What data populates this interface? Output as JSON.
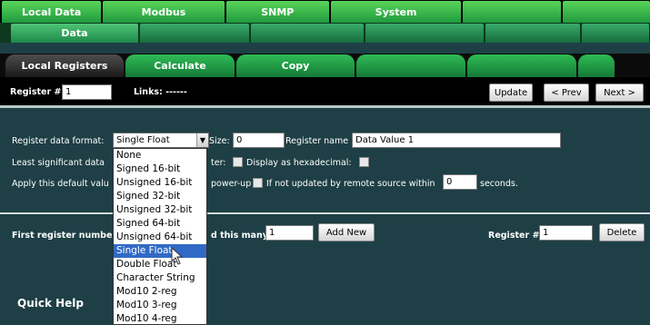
{
  "nav_primary": [
    "Local Data",
    "Modbus",
    "SNMP",
    "System",
    "",
    ""
  ],
  "nav_secondary": [
    "Data",
    "",
    "",
    "",
    "",
    ""
  ],
  "nav_tertiary": [
    "Local Registers",
    "Calculate",
    "Copy",
    "",
    "",
    ""
  ],
  "toolbar": {
    "register_label": "Register #",
    "register_value": "1",
    "links_label": "Links: ------",
    "update": "Update",
    "prev": "< Prev",
    "next": "Next >"
  },
  "form": {
    "format_label": "Register data format:",
    "format_value": "Single Float",
    "size_label": "Size:",
    "size_value": "0",
    "name_label": "Register name",
    "name_value": "Data Value 1",
    "lsd_label": "Least significant data",
    "lsd_rest": "ter:",
    "hex_label": "Display as hexadecimal:",
    "default_label": "Apply this default valu",
    "powerup_label": "power-up",
    "notupdated_label": "If not updated by remote source within",
    "timeout_value": "0",
    "seconds_label": "seconds."
  },
  "add": {
    "first_label": "First register number t",
    "many_label": "d this many:",
    "many_value": "1",
    "add_button": "Add New",
    "register_label": "Register #",
    "register_value": "1",
    "delete_button": "Delete"
  },
  "dropdown_options": [
    "None",
    "Signed 16-bit",
    "Unsigned 16-bit",
    "Signed 32-bit",
    "Unsigned 32-bit",
    "Signed 64-bit",
    "Unsigned 64-bit",
    "Single Float",
    "Double Float",
    "Character String",
    "Mod10 2-reg",
    "Mod10 3-reg",
    "Mod10 4-reg"
  ],
  "selected_option": "Single Float",
  "quick_help": "Quick Help",
  "colors": {
    "tab_green": "#2fbb55",
    "panel": "#1e3f45",
    "highlight": "#316ac5"
  },
  "icons": {
    "dropdown_arrow": "chevron-down-icon",
    "cursor": "mouse-pointer-icon"
  }
}
